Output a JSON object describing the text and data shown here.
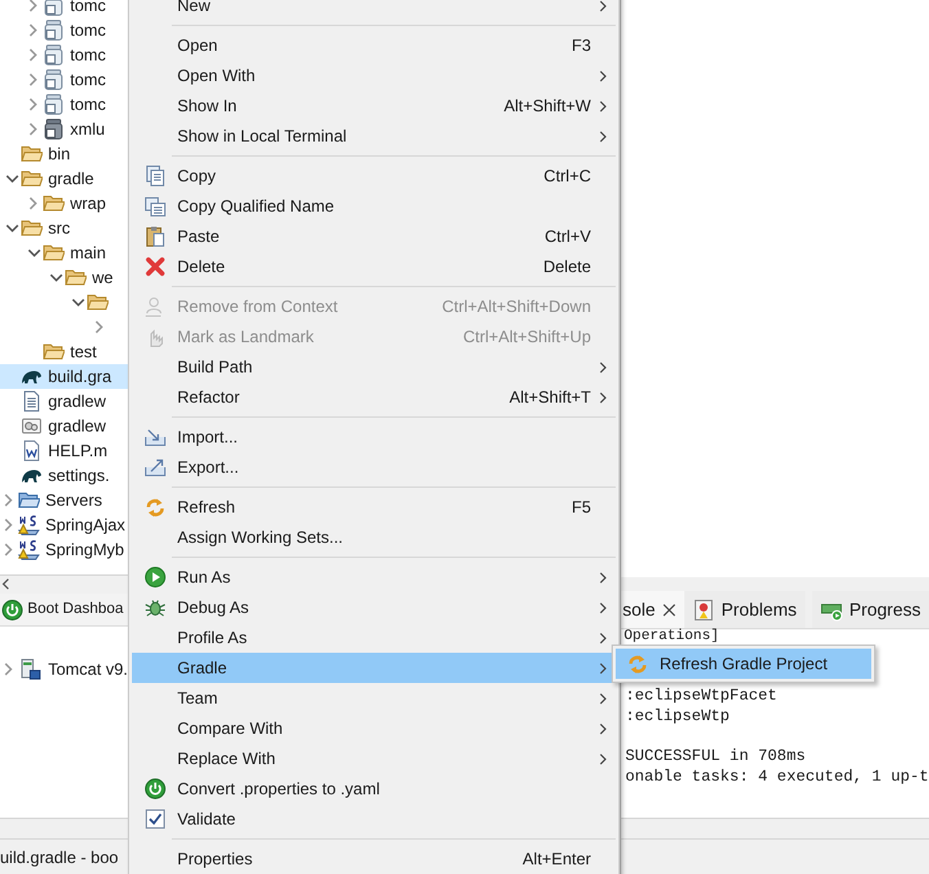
{
  "project_tree": [
    {
      "children": [
        {
          "children": [
            {
              "label": "tomc",
              "kind": "jar",
              "expanded": false,
              "selected": false
            },
            {
              "label": "tomc",
              "kind": "jar",
              "expanded": false,
              "selected": false
            },
            {
              "label": "tomc",
              "kind": "jar",
              "expanded": false,
              "selected": false
            },
            {
              "label": "tomc",
              "kind": "jar",
              "expanded": false,
              "selected": false
            },
            {
              "label": "tomc",
              "kind": "jar",
              "expanded": false,
              "selected": false
            },
            {
              "label": "xmlu",
              "kind": "jar-dark",
              "expanded": false,
              "selected": false
            }
          ]
        },
        {
          "label": "bin",
          "kind": "folder",
          "selected": false
        },
        {
          "label": "gradle",
          "kind": "folder",
          "expanded": true,
          "selected": false,
          "children": [
            {
              "label": "wrap",
              "kind": "folder",
              "expanded": false,
              "selected": false
            }
          ]
        },
        {
          "label": "src",
          "kind": "folder",
          "expanded": true,
          "selected": false,
          "children": [
            {
              "label": "main",
              "kind": "folder",
              "expanded": true,
              "selected": false,
              "children": [
                {
                  "label": "we",
                  "kind": "folder",
                  "expanded": true,
                  "selected": false,
                  "children": [
                    {
                      "kind": "folder",
                      "expanded": true,
                      "selected": false,
                      "children": [
                        {
                          "expanded": false,
                          "selected": false
                        }
                      ]
                    }
                  ]
                }
              ]
            },
            {
              "label": "test",
              "kind": "folder",
              "selected": false
            }
          ]
        },
        {
          "label": "build.gra",
          "kind": "gradle",
          "selected": true
        },
        {
          "label": "gradlew",
          "kind": "text-file",
          "selected": false
        },
        {
          "label": "gradlew",
          "kind": "gear-file",
          "selected": false
        },
        {
          "label": "HELP.m",
          "kind": "word-file",
          "selected": false
        },
        {
          "label": "settings.",
          "kind": "gradle",
          "selected": false
        }
      ]
    },
    {
      "label": "Servers",
      "kind": "server-folder",
      "expanded": false,
      "selected": false
    },
    {
      "label": "SpringAjax",
      "kind": "project",
      "expanded": false,
      "selected": false
    },
    {
      "label": "SpringMyb",
      "kind": "project",
      "expanded": false,
      "selected": false
    }
  ],
  "left_bottom_view": {
    "tab": {
      "label": "Boot Dashboa",
      "selected": true
    },
    "tree": [
      {
        "label": "Tomcat v9.",
        "kind": "server",
        "expanded": false
      }
    ]
  },
  "right_bottom_view": {
    "tabs": [
      {
        "label": "sole",
        "kind": "console",
        "closable": true,
        "selected": true
      },
      {
        "label": "Problems",
        "kind": "problems",
        "closable": false,
        "selected": false
      },
      {
        "label": "Progress",
        "kind": "progress",
        "closable": false,
        "selected": false
      }
    ],
    "console_header": "Operations]",
    "console_paragraphs": [
      [
        ":eclipseWtpFacet",
        ":eclipseWtp"
      ],
      [
        "SUCCESSFUL in 708ms",
        "onable tasks: 4 executed, 1 up-t"
      ]
    ]
  },
  "status_bar": {
    "text": "uild.gradle - boo"
  },
  "context_menu": [
    {
      "kind": "item",
      "label": "New",
      "submenu": true,
      "disabled": false,
      "selected": false
    },
    {
      "kind": "separator"
    },
    {
      "kind": "item",
      "label": "Open",
      "shortcut": "F3",
      "submenu": false,
      "disabled": false,
      "selected": false
    },
    {
      "kind": "item",
      "label": "Open With",
      "submenu": true,
      "disabled": false,
      "selected": false
    },
    {
      "kind": "item",
      "label": "Show In",
      "shortcut": "Alt+Shift+W",
      "submenu": true,
      "disabled": false,
      "selected": false
    },
    {
      "kind": "item",
      "label": "Show in Local Terminal",
      "submenu": true,
      "disabled": false,
      "selected": false
    },
    {
      "kind": "separator"
    },
    {
      "kind": "copy",
      "label": "Copy",
      "shortcut": "Ctrl+C",
      "submenu": false,
      "disabled": false,
      "selected": false
    },
    {
      "kind": "copy-name",
      "label": "Copy Qualified Name",
      "submenu": false,
      "disabled": false,
      "selected": false
    },
    {
      "kind": "paste",
      "label": "Paste",
      "shortcut": "Ctrl+V",
      "submenu": false,
      "disabled": false,
      "selected": false
    },
    {
      "kind": "delete",
      "label": "Delete",
      "shortcut": "Delete",
      "submenu": false,
      "disabled": false,
      "selected": false
    },
    {
      "kind": "separator"
    },
    {
      "kind": "remove-context",
      "label": "Remove from Context",
      "shortcut": "Ctrl+Alt+Shift+Down",
      "submenu": false,
      "disabled": true,
      "selected": false
    },
    {
      "kind": "landmark",
      "label": "Mark as Landmark",
      "shortcut": "Ctrl+Alt+Shift+Up",
      "submenu": false,
      "disabled": true,
      "selected": false
    },
    {
      "kind": "item",
      "label": "Build Path",
      "submenu": true,
      "disabled": false,
      "selected": false
    },
    {
      "kind": "item",
      "label": "Refactor",
      "shortcut": "Alt+Shift+T",
      "submenu": true,
      "disabled": false,
      "selected": false
    },
    {
      "kind": "separator"
    },
    {
      "kind": "import",
      "label": "Import...",
      "submenu": false,
      "disabled": false,
      "selected": false
    },
    {
      "kind": "export",
      "label": "Export...",
      "submenu": false,
      "disabled": false,
      "selected": false
    },
    {
      "kind": "separator"
    },
    {
      "kind": "refresh",
      "label": "Refresh",
      "shortcut": "F5",
      "submenu": false,
      "disabled": false,
      "selected": false
    },
    {
      "kind": "item",
      "label": "Assign Working Sets...",
      "submenu": false,
      "disabled": false,
      "selected": false
    },
    {
      "kind": "separator"
    },
    {
      "kind": "run",
      "label": "Run As",
      "submenu": true,
      "disabled": false,
      "selected": false
    },
    {
      "kind": "debug",
      "label": "Debug As",
      "submenu": true,
      "disabled": false,
      "selected": false
    },
    {
      "kind": "item",
      "label": "Profile As",
      "submenu": true,
      "disabled": false,
      "selected": false
    },
    {
      "kind": "item",
      "label": "Gradle",
      "submenu": true,
      "disabled": false,
      "selected": true
    },
    {
      "kind": "item",
      "label": "Team",
      "submenu": true,
      "disabled": false,
      "selected": false
    },
    {
      "kind": "item",
      "label": "Compare With",
      "submenu": true,
      "disabled": false,
      "selected": false
    },
    {
      "kind": "item",
      "label": "Replace With",
      "submenu": true,
      "disabled": false,
      "selected": false
    },
    {
      "kind": "power",
      "label": "Convert .properties to .yaml",
      "submenu": false,
      "disabled": false,
      "selected": false
    },
    {
      "kind": "validate",
      "label": "Validate",
      "submenu": false,
      "disabled": false,
      "selected": false
    },
    {
      "kind": "separator"
    },
    {
      "kind": "item",
      "label": "Properties",
      "shortcut": "Alt+Enter",
      "submenu": false,
      "disabled": false,
      "selected": false
    }
  ],
  "gradle_submenu": [
    {
      "label": "Refresh Gradle Project",
      "kind": "refresh",
      "selected": true
    }
  ]
}
